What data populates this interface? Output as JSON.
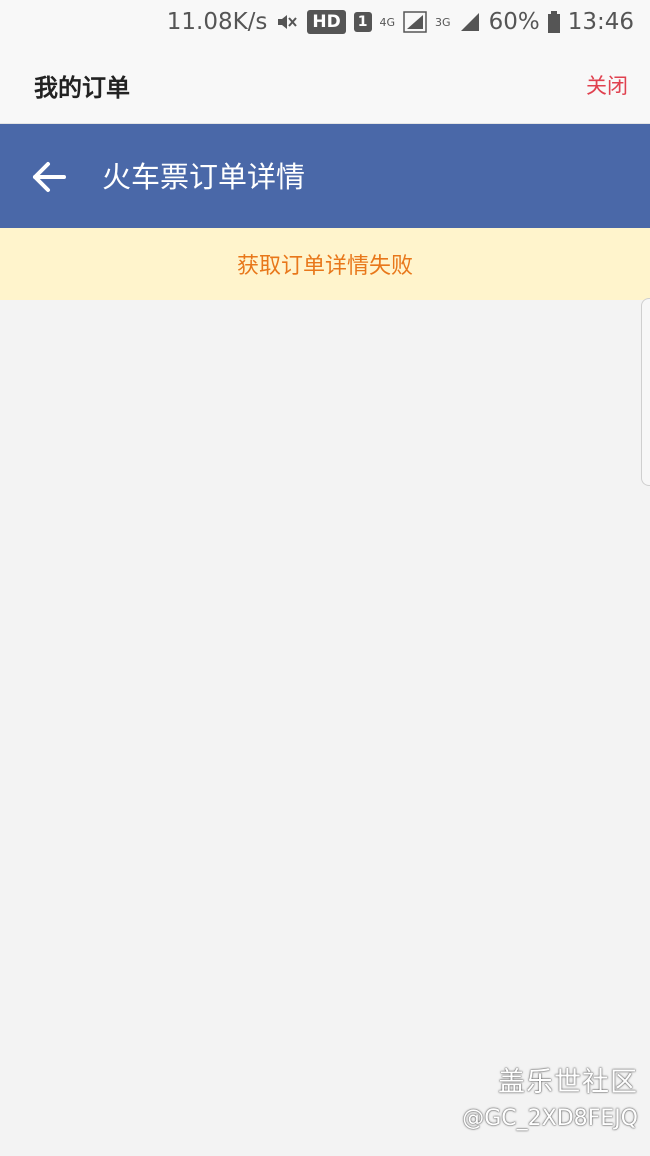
{
  "status_bar": {
    "speed": "11.08K/s",
    "hd": "HD",
    "sim": "1",
    "net_4g": "4G",
    "net_3g": "3G",
    "battery": "60%",
    "time": "13:46"
  },
  "top_bar": {
    "title": "我的订单",
    "close_label": "关闭"
  },
  "header": {
    "title": "火车票订单详情"
  },
  "error_banner": {
    "message": "获取订单详情失败"
  },
  "watermark": {
    "line1": "盖乐世社区",
    "line2": "@GC_2XD8FEJQ"
  },
  "colors": {
    "header_bg": "#4a68a8",
    "close_text": "#e0414f",
    "error_text": "#e8771a",
    "error_bg": "#fff4cc",
    "page_bg": "#f3f3f3"
  }
}
